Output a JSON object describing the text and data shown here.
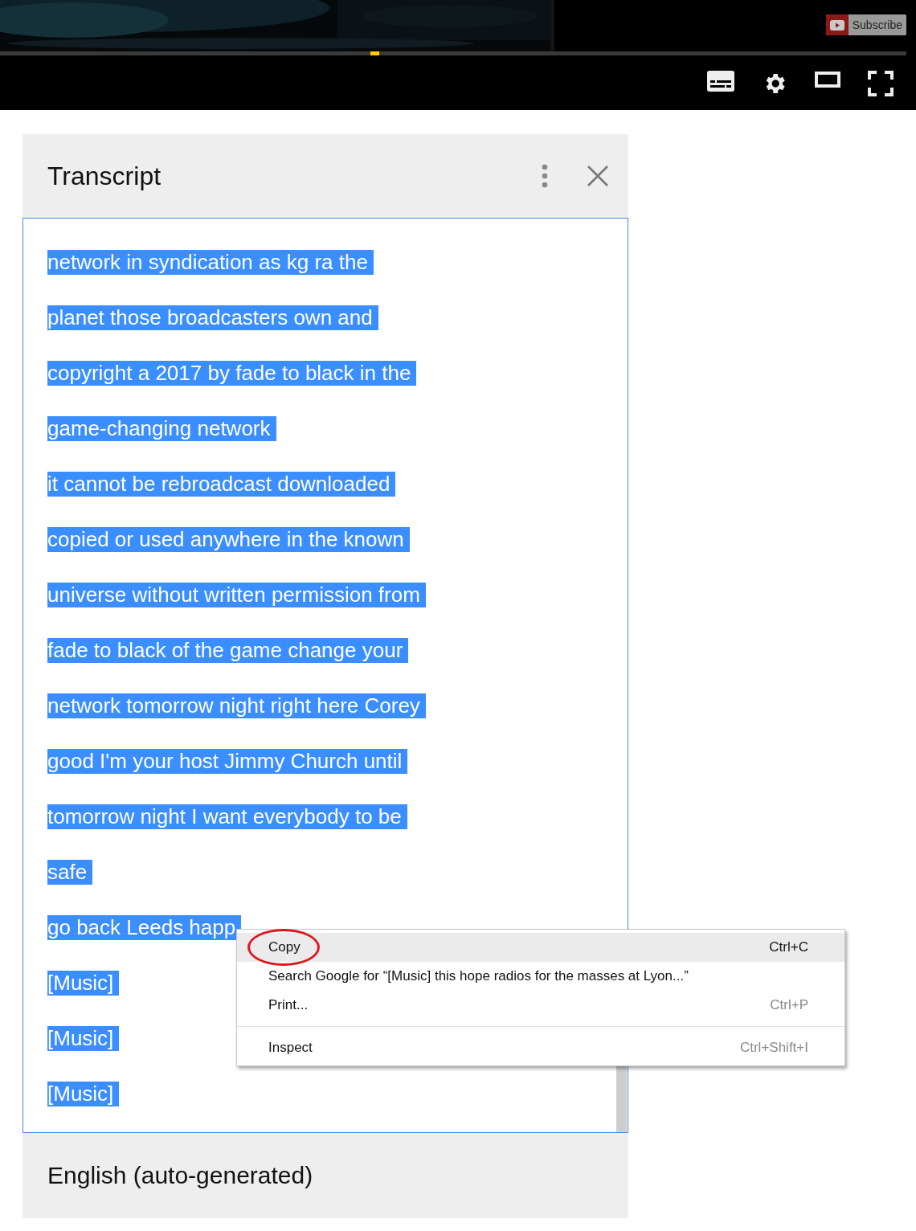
{
  "player": {
    "subscribe": "Subscribe",
    "progress": {
      "level": 0
    }
  },
  "transcript": {
    "title": "Transcript",
    "lines": [
      {
        "text": "network in syndication as kg ra the",
        "selected": true
      },
      {
        "text": "planet those broadcasters own and",
        "selected": true
      },
      {
        "text": "copyright a 2017 by fade to black in the",
        "selected": true
      },
      {
        "text": "game-changing network",
        "selected": true
      },
      {
        "text": "it cannot be rebroadcast downloaded",
        "selected": true
      },
      {
        "text": "copied or used anywhere in the known",
        "selected": true
      },
      {
        "text": "universe without written permission from",
        "selected": true
      },
      {
        "text": "fade to black of the game change your",
        "selected": true
      },
      {
        "text": "network tomorrow night right here Corey",
        "selected": true
      },
      {
        "text": "good I'm your host Jimmy Church until",
        "selected": true
      },
      {
        "text": "tomorrow night I want everybody to be",
        "selected": true
      },
      {
        "text": "safe",
        "selected": true
      },
      {
        "text": "go back Leeds happ",
        "selected": true
      },
      {
        "text": "[Music]",
        "selected": true
      },
      {
        "text": "[Music]",
        "selected": true
      },
      {
        "text": "[Music]",
        "selected": true
      }
    ],
    "language": "English (auto-generated)"
  },
  "context_menu": {
    "groups": [
      [
        {
          "label": "Copy",
          "shortcut": "Ctrl+C",
          "selected": true,
          "circled": true
        },
        {
          "label": "Search Google for “[Music] this hope radios for the masses at Lyon...”",
          "selected": false,
          "circled": false
        },
        {
          "label": "Print...",
          "shortcut": "Ctrl+P",
          "selected": false,
          "circled": false
        }
      ],
      [
        {
          "label": "Inspect",
          "shortcut": "Ctrl+Shift+I",
          "selected": false,
          "circled": false
        }
      ]
    ]
  }
}
